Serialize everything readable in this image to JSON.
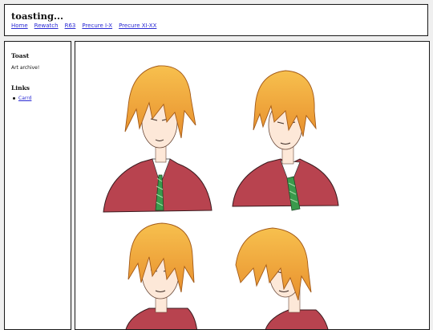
{
  "header": {
    "title": "toasting...",
    "nav": [
      "Home",
      "Rewatch",
      "R63",
      "Precure I-X",
      "Precure XI-XX"
    ]
  },
  "sidebar": {
    "title": "Toast",
    "description": "Art archive!",
    "links_heading": "Links",
    "links": [
      "Carrd"
    ]
  },
  "main": {
    "artwork_alt": "four sketches of a blond boy in a red blazer and green striped tie"
  },
  "colors": {
    "link": "#2b2bd4",
    "hair": "#f0a83c",
    "blazer": "#b8434f",
    "tie": "#3a9a4c"
  }
}
